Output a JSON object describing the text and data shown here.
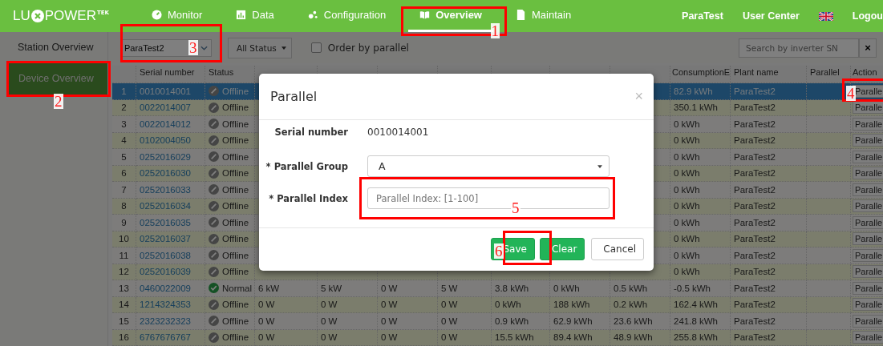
{
  "logo": {
    "before": "LU",
    "after": "POWER",
    "suffix": "TEK"
  },
  "nav": [
    {
      "label": "Monitor",
      "selected": false
    },
    {
      "label": "Data",
      "selected": false
    },
    {
      "label": "Configuration",
      "selected": false
    },
    {
      "label": "Overview",
      "selected": true
    },
    {
      "label": "Maintain",
      "selected": false
    }
  ],
  "user_links": [
    "ParaTest",
    "User Center"
  ],
  "logout": "Logou",
  "sidebar": {
    "items": [
      {
        "label": "Station Overview",
        "selected": false
      },
      {
        "label": "Device Overview",
        "selected": true
      }
    ]
  },
  "filters": {
    "plant": "ParaTest2",
    "status": "All Status",
    "order_by_parallel": {
      "label": "Order by parallel",
      "checked": false
    },
    "search": {
      "placeholder": "Search by inverter SN"
    },
    "clear": "×"
  },
  "table": {
    "columns": [
      "Serial number",
      "Status",
      "ConsumptionE",
      "Plant name",
      "Parallel",
      "Action"
    ],
    "rows": [
      {
        "no": "1",
        "serial": "0010014001",
        "status": "Offline",
        "kind": "offline",
        "consumption": "82.9 kWh",
        "plant": "ParaTest2",
        "action": "Paralle",
        "selected": true
      },
      {
        "no": "2",
        "serial": "0022014007",
        "status": "Offline",
        "kind": "offline",
        "consumption": "350.1 kWh",
        "plant": "ParaTest2",
        "action": "Paralle",
        "selected": false
      },
      {
        "no": "3",
        "serial": "0022014012",
        "status": "Offline",
        "kind": "offline",
        "consumption": "0 kWh",
        "plant": "ParaTest2",
        "action": "Paralle",
        "selected": false
      },
      {
        "no": "4",
        "serial": "0102004050",
        "status": "Offline",
        "kind": "offline",
        "consumption": "0 kWh",
        "plant": "ParaTest2",
        "action": "Paralle",
        "selected": false
      },
      {
        "no": "5",
        "serial": "0252016029",
        "status": "Offline",
        "kind": "offline",
        "consumption": "0 kWh",
        "plant": "ParaTest2",
        "action": "Paralle",
        "selected": false
      },
      {
        "no": "6",
        "serial": "0252016030",
        "status": "Offline",
        "kind": "offline",
        "consumption": "0 kWh",
        "plant": "ParaTest2",
        "action": "Paralle",
        "selected": false
      },
      {
        "no": "7",
        "serial": "0252016033",
        "status": "Offline",
        "kind": "offline",
        "consumption": "0 kWh",
        "plant": "ParaTest2",
        "action": "Paralle",
        "selected": false
      },
      {
        "no": "8",
        "serial": "0252016034",
        "status": "Offline",
        "kind": "offline",
        "consumption": "0 kWh",
        "plant": "ParaTest2",
        "action": "Paralle",
        "selected": false
      },
      {
        "no": "9",
        "serial": "0252016035",
        "status": "Offline",
        "kind": "offline",
        "consumption": "0 kWh",
        "plant": "ParaTest2",
        "action": "Paralle",
        "selected": false
      },
      {
        "no": "10",
        "serial": "0252016037",
        "status": "Offline",
        "kind": "offline",
        "consumption": "0 kWh",
        "plant": "ParaTest2",
        "action": "Paralle",
        "selected": false
      },
      {
        "no": "11",
        "serial": "0252016038",
        "status": "Offline",
        "kind": "offline",
        "consumption": "0 kWh",
        "plant": "ParaTest2",
        "action": "Paralle",
        "selected": false
      },
      {
        "no": "12",
        "serial": "0252016039",
        "status": "Offline",
        "kind": "offline",
        "consumption": "0 kWh",
        "plant": "ParaTest2",
        "action": "Paralle",
        "selected": false
      },
      {
        "no": "13",
        "serial": "0460022009",
        "status": "Normal",
        "kind": "normal",
        "values": [
          "6 kW",
          "5 kW",
          "0 W",
          "5 W",
          "3.8 kWh",
          "0 kWh",
          "0.5 kWh"
        ],
        "consumption": "-0.5 kWh",
        "plant": "ParaTest2",
        "action": "Paralle",
        "selected": false
      },
      {
        "no": "14",
        "serial": "1214324353",
        "status": "Offline",
        "kind": "offline",
        "values": [
          "0 W",
          "0 W",
          "0 W",
          "0 W",
          "0 kWh",
          "188 kWh",
          "0.2 kWh"
        ],
        "consumption": "162.4 kWh",
        "plant": "ParaTest2",
        "action": "Paralle",
        "selected": false
      },
      {
        "no": "15",
        "serial": "2323232323",
        "status": "Offline",
        "kind": "offline",
        "values": [
          "0 W",
          "0 W",
          "0 W",
          "0 W",
          "0.9 kWh",
          "62.9 kWh",
          "23.6 kWh"
        ],
        "consumption": "241.8 kWh",
        "plant": "ParaTest2",
        "action": "Paralle",
        "selected": false
      },
      {
        "no": "16",
        "serial": "6767676767",
        "status": "Offline",
        "kind": "offline",
        "values": [
          "0 W",
          "0 W",
          "0 W",
          "0 W",
          "15.5 kWh",
          "89.4 kWh",
          "48.9 kWh"
        ],
        "consumption": "255.8 kWh",
        "plant": "ParaTest2",
        "action": "Paralle",
        "selected": false
      }
    ]
  },
  "dialog": {
    "title": "Parallel",
    "close": "×",
    "serial": {
      "label": "Serial number",
      "value": "0010014001"
    },
    "group": {
      "label": "* Parallel Group",
      "value": "A"
    },
    "index": {
      "label": "* Parallel Index",
      "placeholder": "Parallel Index: [1-100]"
    },
    "buttons": [
      {
        "label": "Save",
        "kind": "primary"
      },
      {
        "label": "Clear",
        "kind": "primary"
      },
      {
        "label": "Cancel",
        "kind": "default"
      }
    ]
  },
  "annotations": [
    {
      "label": "1"
    },
    {
      "label": "2"
    },
    {
      "label": "3"
    },
    {
      "label": "4"
    },
    {
      "label": "5"
    },
    {
      "label": "6"
    }
  ]
}
